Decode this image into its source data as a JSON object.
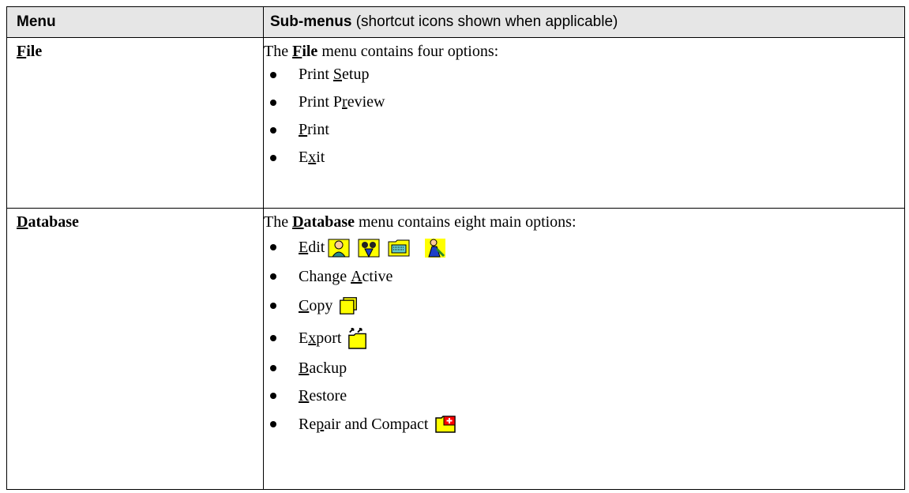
{
  "header": {
    "menu": "Menu",
    "submenus_bold": "Sub-menus",
    "submenus_rest": " (shortcut icons shown when applicable)"
  },
  "file": {
    "menu_first": "F",
    "menu_rest": "ile",
    "desc_pre": "The ",
    "desc_first": "F",
    "desc_rest": "ile",
    "desc_post": " menu contains four options:",
    "items": [
      {
        "pre": "Print ",
        "u": "S",
        "post": "etup"
      },
      {
        "pre": "Print P",
        "u": "r",
        "post": "eview"
      },
      {
        "pre": "",
        "u": "P",
        "post": "rint"
      },
      {
        "pre": "E",
        "u": "x",
        "post": "it"
      }
    ]
  },
  "database": {
    "menu_first": "D",
    "menu_rest": "atabase",
    "desc_pre": "The ",
    "desc_first": "D",
    "desc_rest": "atabase",
    "desc_post": " menu contains eight main options:",
    "items": [
      {
        "pre": "",
        "u": "E",
        "post": "dit",
        "icons": [
          "edit-person-icon",
          "edit-people-icon",
          "edit-keyboard-folder-icon",
          "edit-user-wrench-icon"
        ]
      },
      {
        "pre": "Change ",
        "u": "A",
        "post": "ctive"
      },
      {
        "pre": "",
        "u": "C",
        "post": "opy",
        "icons": [
          "copy-folder-icon"
        ]
      },
      {
        "pre": "E",
        "u": "x",
        "post": "port",
        "icons": [
          "export-folder-icon"
        ]
      },
      {
        "pre": "",
        "u": "B",
        "post": "ackup"
      },
      {
        "pre": "",
        "u": "R",
        "post": "estore"
      },
      {
        "pre": "Re",
        "u": "p",
        "post": "air and Compact",
        "icons": [
          "repair-folder-icon"
        ]
      }
    ]
  },
  "colors": {
    "header_bg": "#e6e6e6",
    "icon_yellow": "#ffff00",
    "icon_red": "#ff0000"
  }
}
